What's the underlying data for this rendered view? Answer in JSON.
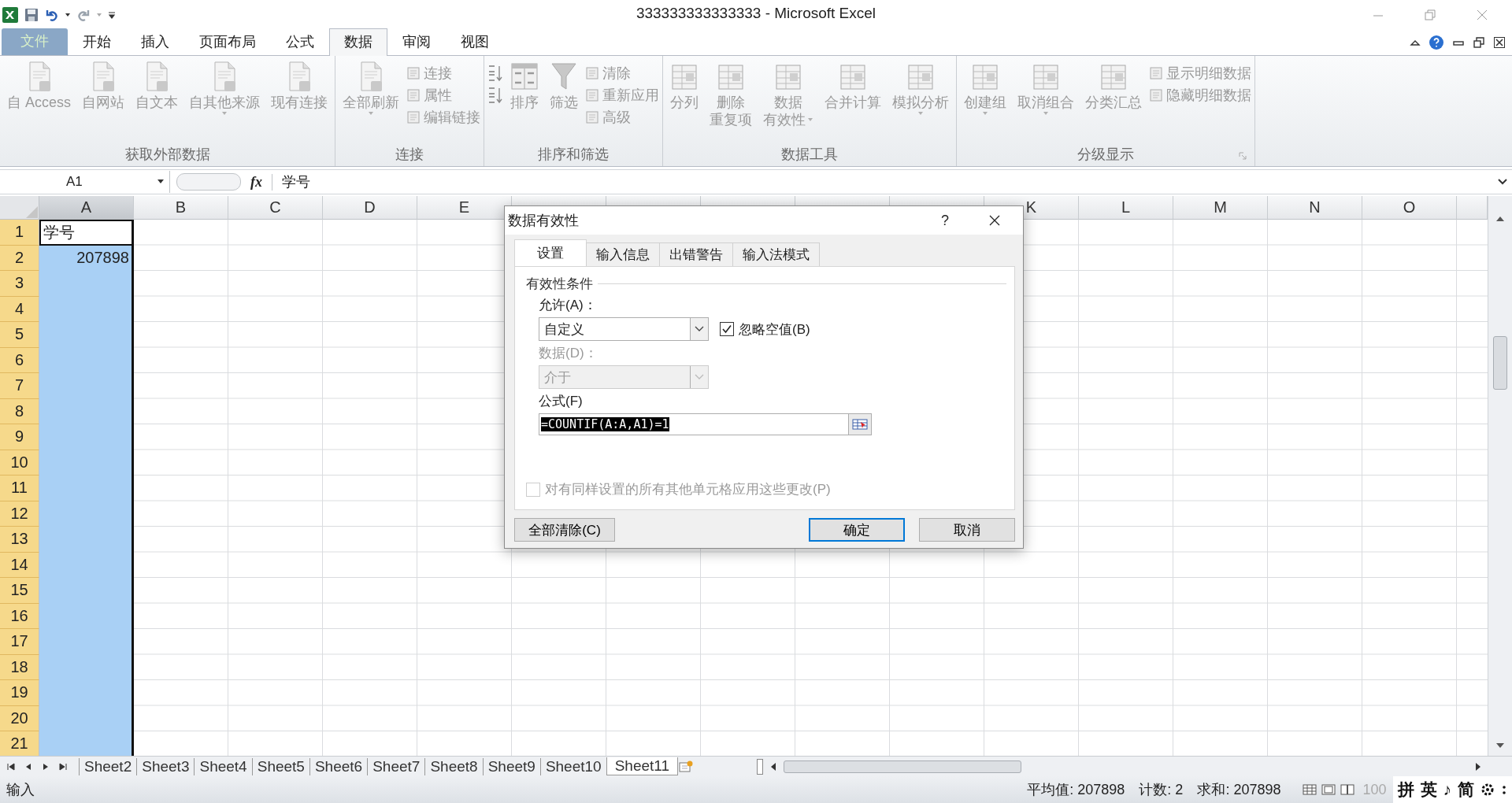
{
  "window": {
    "title": "333333333333333 - Microsoft Excel"
  },
  "ribbon_tabs": [
    {
      "label": "文件",
      "kind": "file",
      "selected": false
    },
    {
      "label": "开始",
      "kind": "tab",
      "selected": false
    },
    {
      "label": "插入",
      "kind": "tab",
      "selected": false
    },
    {
      "label": "页面布局",
      "kind": "tab",
      "selected": false
    },
    {
      "label": "公式",
      "kind": "tab",
      "selected": false
    },
    {
      "label": "数据",
      "kind": "tab",
      "selected": true
    },
    {
      "label": "审阅",
      "kind": "tab",
      "selected": false
    },
    {
      "label": "视图",
      "kind": "tab",
      "selected": false
    }
  ],
  "ribbon_groups": [
    {
      "label": "获取外部数据",
      "launcher": false,
      "items": [
        {
          "kind": "large",
          "lines": [
            "自 Access"
          ],
          "dropdown": false
        },
        {
          "kind": "large",
          "lines": [
            "自网站"
          ],
          "dropdown": false
        },
        {
          "kind": "large",
          "lines": [
            "自文本"
          ],
          "dropdown": false
        },
        {
          "kind": "large",
          "lines": [
            "自其他来源"
          ],
          "dropdown": true
        },
        {
          "kind": "large",
          "lines": [
            "现有连接"
          ],
          "dropdown": false
        }
      ]
    },
    {
      "label": "连接",
      "launcher": false,
      "items": [
        {
          "kind": "large",
          "lines": [
            "全部刷新"
          ],
          "dropdown": true
        },
        {
          "kind": "stack",
          "items": [
            {
              "kind": "text",
              "label": "连接"
            },
            {
              "kind": "text",
              "label": "属性"
            },
            {
              "kind": "text",
              "label": "编辑链接"
            }
          ]
        }
      ]
    },
    {
      "label": "排序和筛选",
      "launcher": false,
      "items": [
        {
          "kind": "stack",
          "items": [
            {
              "kind": "icon"
            },
            {
              "kind": "icon"
            }
          ]
        },
        {
          "kind": "large",
          "lines": [
            "排序"
          ],
          "dropdown": false
        },
        {
          "kind": "large",
          "lines": [
            "筛选"
          ],
          "dropdown": false
        },
        {
          "kind": "stack",
          "items": [
            {
              "kind": "text",
              "label": "清除"
            },
            {
              "kind": "text",
              "label": "重新应用"
            },
            {
              "kind": "text",
              "label": "高级"
            }
          ]
        }
      ]
    },
    {
      "label": "数据工具",
      "launcher": false,
      "items": [
        {
          "kind": "large",
          "lines": [
            "分列"
          ],
          "dropdown": false
        },
        {
          "kind": "large",
          "lines": [
            "删除",
            "重复项"
          ],
          "dropdown": false
        },
        {
          "kind": "large",
          "lines": [
            "数据",
            "有效性"
          ],
          "dropdown": true
        },
        {
          "kind": "large",
          "lines": [
            "合并计算"
          ],
          "dropdown": false
        },
        {
          "kind": "large",
          "lines": [
            "模拟分析"
          ],
          "dropdown": true
        }
      ]
    },
    {
      "label": "分级显示",
      "launcher": true,
      "items": [
        {
          "kind": "large",
          "lines": [
            "创建组"
          ],
          "dropdown": true
        },
        {
          "kind": "large",
          "lines": [
            "取消组合"
          ],
          "dropdown": true
        },
        {
          "kind": "large",
          "lines": [
            "分类汇总"
          ],
          "dropdown": false
        },
        {
          "kind": "stack",
          "items": [
            {
              "kind": "text",
              "label": "显示明细数据"
            },
            {
              "kind": "text",
              "label": "隐藏明细数据"
            }
          ]
        }
      ]
    }
  ],
  "formula_bar": {
    "name_box": "A1",
    "fx": "fx",
    "value": "学号"
  },
  "columns": [
    {
      "label": "A",
      "selected": true
    },
    {
      "label": "B",
      "selected": false
    },
    {
      "label": "C",
      "selected": false
    },
    {
      "label": "D",
      "selected": false
    },
    {
      "label": "E",
      "selected": false
    },
    {
      "selected": false
    },
    {
      "selected": false
    },
    {
      "selected": false
    },
    {
      "selected": false
    },
    {
      "selected": false
    },
    {
      "label": "K",
      "selected": false
    },
    {
      "label": "L",
      "selected": false
    },
    {
      "label": "M",
      "selected": false
    },
    {
      "label": "N",
      "selected": false
    },
    {
      "label": "O",
      "selected": false
    }
  ],
  "rows": [
    {
      "label": "1",
      "selected": true,
      "cells": [
        {
          "text": "学号",
          "kind": "text",
          "active": true
        }
      ]
    },
    {
      "label": "2",
      "selected": true,
      "cells": [
        {
          "text": "207898",
          "kind": "number",
          "active": false
        }
      ]
    },
    {
      "label": "3",
      "selected": true
    },
    {
      "label": "4",
      "selected": true
    },
    {
      "label": "5",
      "selected": true
    },
    {
      "label": "6",
      "selected": true
    },
    {
      "label": "7",
      "selected": true
    },
    {
      "label": "8",
      "selected": true
    },
    {
      "label": "9",
      "selected": true
    },
    {
      "label": "10",
      "selected": true
    },
    {
      "label": "11",
      "selected": true
    },
    {
      "label": "12",
      "selected": true
    },
    {
      "label": "13",
      "selected": true
    },
    {
      "label": "14",
      "selected": true
    },
    {
      "label": "15",
      "selected": true
    },
    {
      "label": "16",
      "selected": true
    },
    {
      "label": "17",
      "selected": true
    },
    {
      "label": "18",
      "selected": true
    },
    {
      "label": "19",
      "selected": true
    },
    {
      "label": "20",
      "selected": true
    },
    {
      "label": "21",
      "selected": true
    }
  ],
  "dialog": {
    "title": "数据有效性",
    "help": "?",
    "tabs": [
      {
        "label": "设置",
        "selected": true
      },
      {
        "label": "输入信息",
        "selected": false
      },
      {
        "label": "出错警告",
        "selected": false
      },
      {
        "label": "输入法模式",
        "selected": false
      }
    ],
    "section": "有效性条件",
    "allow_label": "允许(A)：",
    "allow_value": "自定义",
    "ignore_blank": {
      "label": "忽略空值(B)",
      "checked": true
    },
    "data_label": "数据(D)：",
    "data_value": "介于",
    "data_disabled": true,
    "formula_label": "公式(F)",
    "formula_value": "=COUNTIF(A:A,A1)=1",
    "formula_selected": true,
    "apply_all": {
      "label": "对有同样设置的所有其他单元格应用这些更改(P)",
      "checked": false,
      "disabled": true
    },
    "buttons": [
      {
        "label": "全部清除(C)",
        "kind": "clear"
      },
      {
        "label": "确定",
        "kind": "ok"
      },
      {
        "label": "取消",
        "kind": "cancel"
      }
    ]
  },
  "sheet_tabs": [
    {
      "label": "Sheet2",
      "selected": false
    },
    {
      "label": "Sheet3",
      "selected": false
    },
    {
      "label": "Sheet4",
      "selected": false
    },
    {
      "label": "Sheet5",
      "selected": false
    },
    {
      "label": "Sheet6",
      "selected": false
    },
    {
      "label": "Sheet7",
      "selected": false
    },
    {
      "label": "Sheet8",
      "selected": false
    },
    {
      "label": "Sheet9",
      "selected": false
    },
    {
      "label": "Sheet10",
      "selected": false
    },
    {
      "label": "Sheet11",
      "selected": true
    }
  ],
  "status_bar": {
    "mode": "输入",
    "stats": [
      "平均值: 207898",
      "计数: 2",
      "求和: 207898"
    ],
    "zoom": "100",
    "ime": [
      "拼",
      "英",
      "♪",
      "简"
    ]
  }
}
